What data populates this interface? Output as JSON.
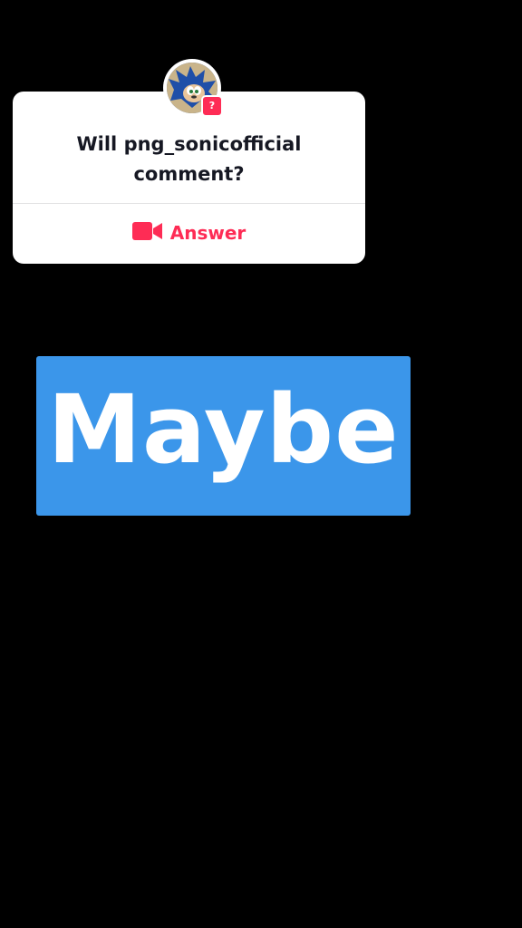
{
  "qa_card": {
    "question": "Will png_sonicofficial comment?",
    "answer_label": "Answer",
    "badge": "?"
  },
  "caption": {
    "text": "Maybe"
  },
  "colors": {
    "background": "#000000",
    "accent": "#fe2c55",
    "caption_bg": "#3b96ea"
  }
}
